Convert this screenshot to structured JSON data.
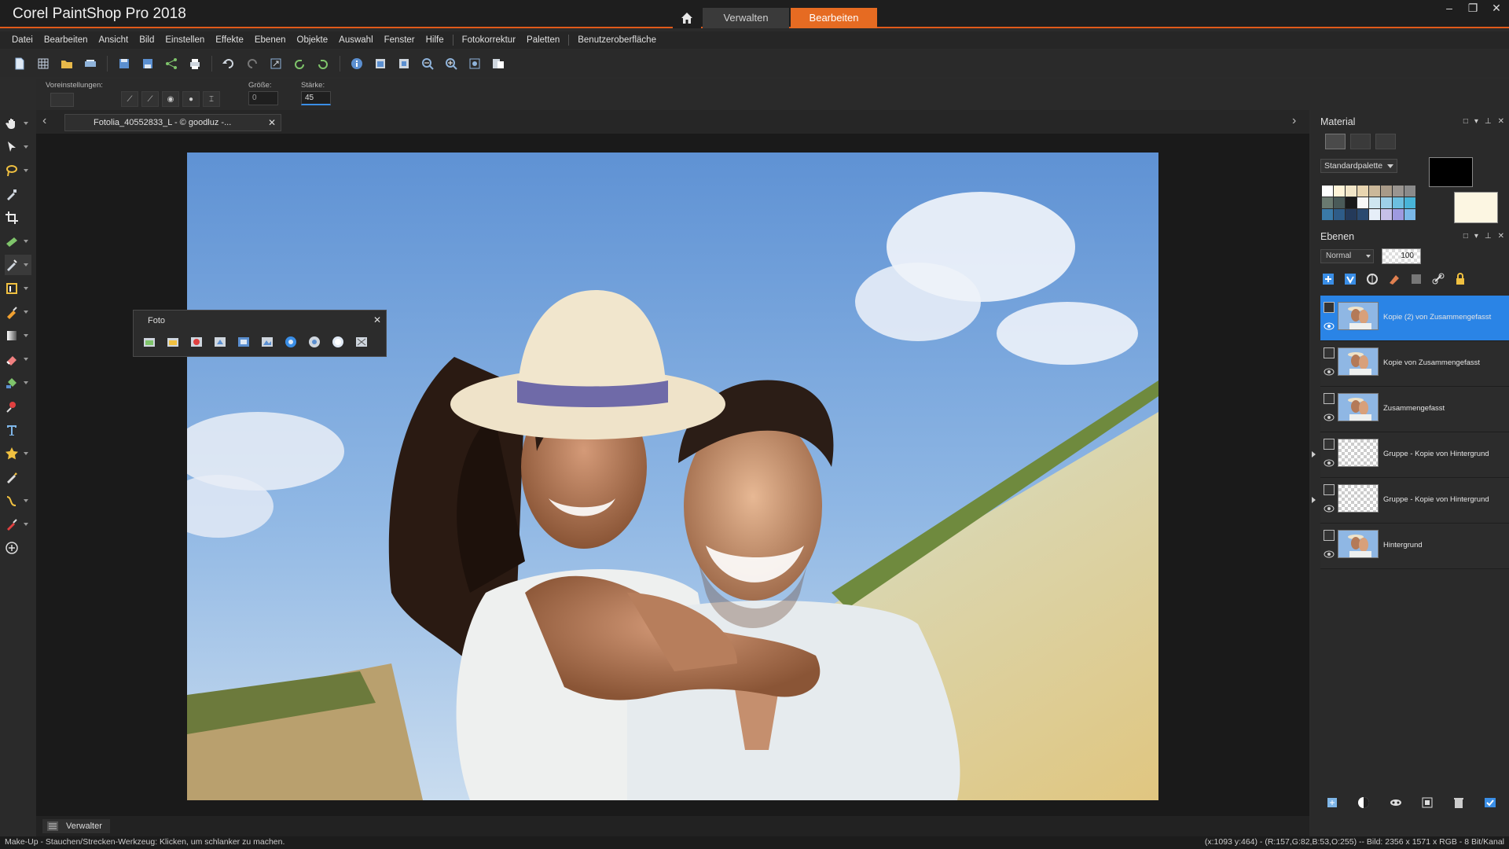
{
  "app": {
    "title": "Corel PaintShop Pro 2018",
    "mode_tabs": [
      {
        "label": "Verwalten",
        "active": false
      },
      {
        "label": "Bearbeiten",
        "active": true
      }
    ],
    "accent_color": "#e66b22"
  },
  "menu": [
    "Datei",
    "Bearbeiten",
    "Ansicht",
    "Bild",
    "Einstellen",
    "Effekte",
    "Ebenen",
    "Objekte",
    "Auswahl",
    "Fenster",
    "Hilfe",
    "Fotokorrektur",
    "Paletten",
    "Benutzeroberfläche"
  ],
  "tool_options": {
    "presets_label": "Voreinstellungen:",
    "size_label": "Größe:",
    "size_value": "0",
    "strength_label": "Stärke:",
    "strength_value": "45"
  },
  "document": {
    "tab_title": "Fotolia_40552833_L - © goodluz -..."
  },
  "foto_palette": {
    "title": "Foto"
  },
  "bottom_tab": {
    "label": "Verwalter"
  },
  "material": {
    "title": "Material",
    "palette_name": "Standardpalette",
    "foreground_color": "#000000",
    "background_color": "#fcf6e2"
  },
  "layers_panel": {
    "title": "Ebenen",
    "blend_mode": "Normal",
    "opacity": "100",
    "layers": [
      {
        "name": "Kopie (2) von Zusammengefasst",
        "selected": true,
        "group": false,
        "thumb": "photo"
      },
      {
        "name": "Kopie von Zusammengefasst",
        "selected": false,
        "group": false,
        "thumb": "photo"
      },
      {
        "name": "Zusammengefasst",
        "selected": false,
        "group": false,
        "thumb": "photo"
      },
      {
        "name": "Gruppe - Kopie von Hintergrund",
        "selected": false,
        "group": true,
        "thumb": "checker"
      },
      {
        "name": "Gruppe - Kopie von Hintergrund",
        "selected": false,
        "group": true,
        "thumb": "checker"
      },
      {
        "name": "Hintergrund",
        "selected": false,
        "group": false,
        "thumb": "photo"
      }
    ]
  },
  "status": {
    "left": "Make-Up - Stauchen/Strecken-Werkzeug: Klicken, um schlanker zu machen.",
    "right": "(x:1093 y:464) - (R:157,G:82,B:53,O:255) -- Bild:  2356 x 1571 x RGB - 8 Bit/Kanal"
  }
}
